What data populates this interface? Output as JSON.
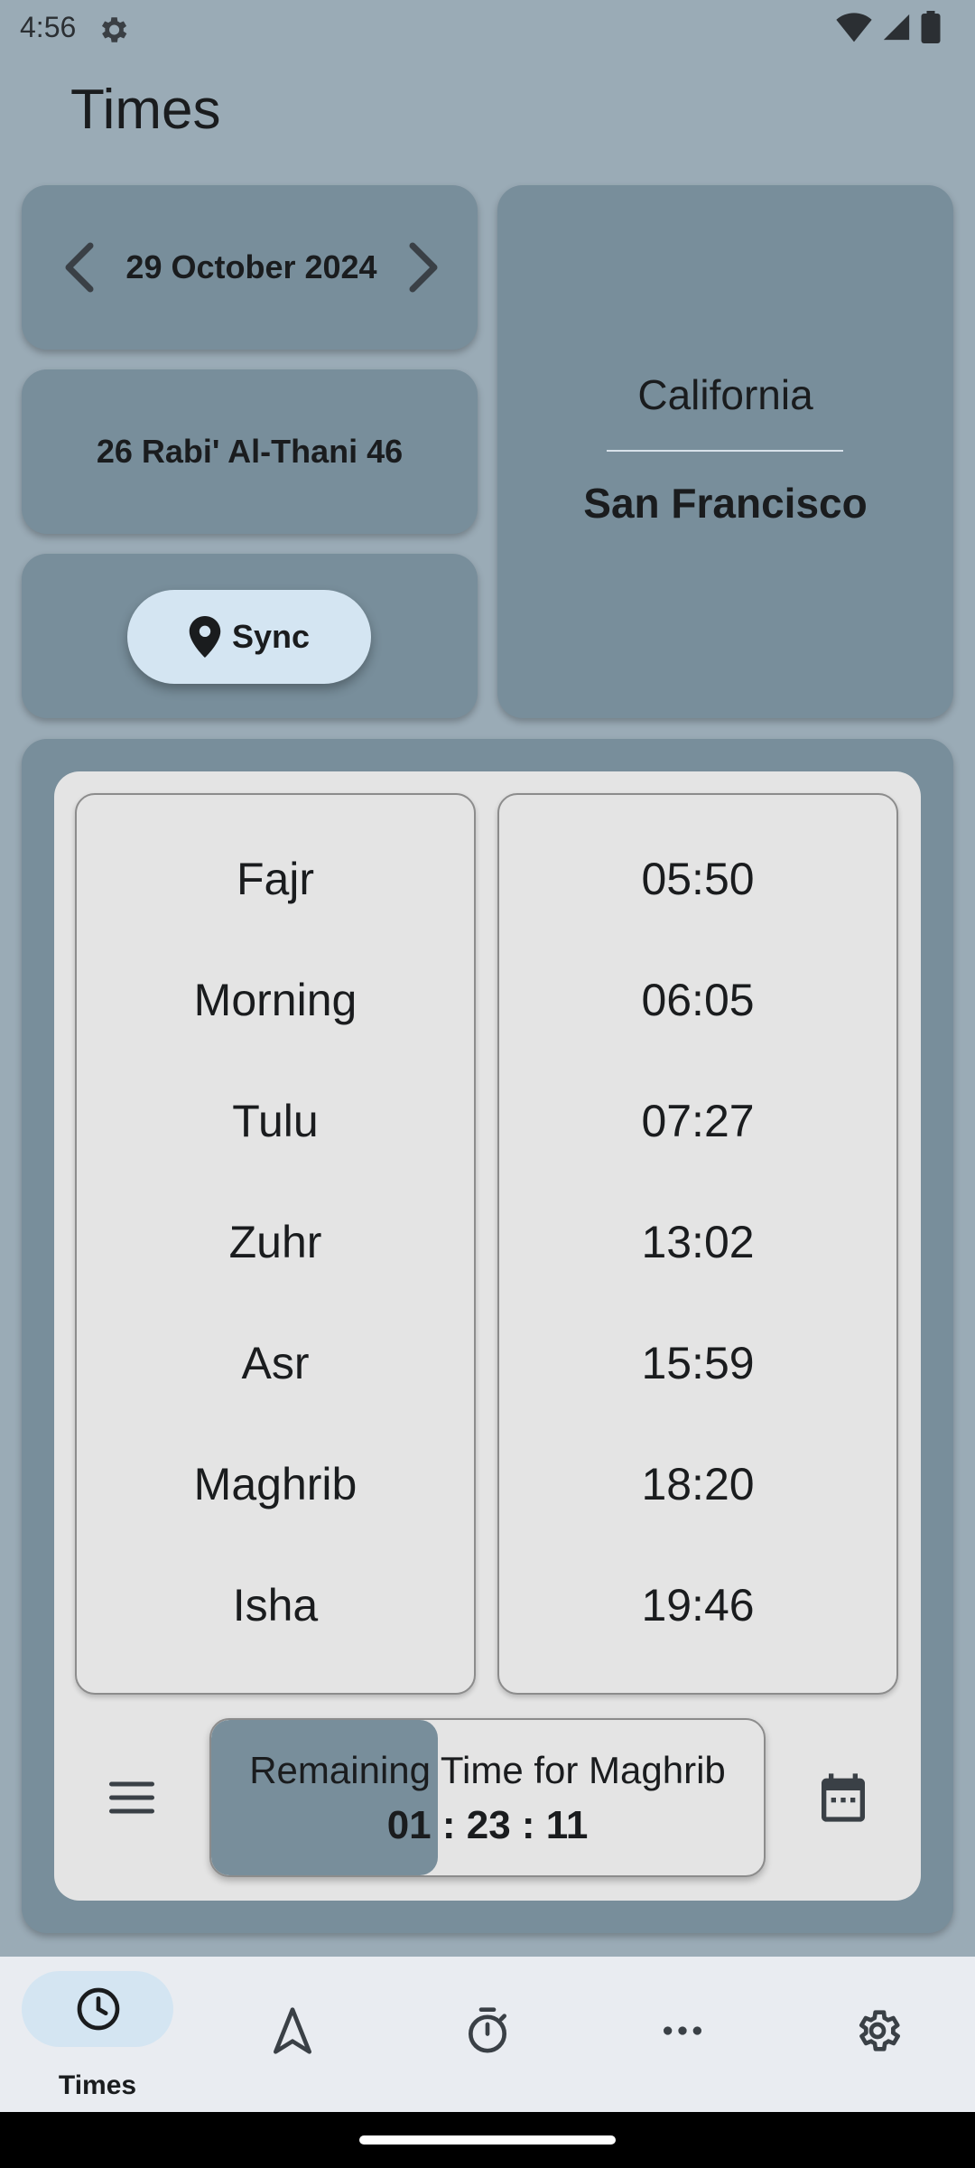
{
  "status_bar": {
    "time": "4:56",
    "icons": [
      "settings-icon",
      "wifi-icon",
      "cell-signal-icon",
      "battery-icon"
    ]
  },
  "header": {
    "title": "Times"
  },
  "date_card": {
    "gregorian": "29 October 2024"
  },
  "hijri_card": {
    "hijri": "26 Rabi' Al-Thani 46"
  },
  "sync": {
    "label": "Sync"
  },
  "location": {
    "region": "California",
    "city": "San Francisco"
  },
  "prayers": [
    {
      "name": "Fajr",
      "time": "05:50"
    },
    {
      "name": "Morning",
      "time": "06:05"
    },
    {
      "name": "Tulu",
      "time": "07:27"
    },
    {
      "name": "Zuhr",
      "time": "13:02"
    },
    {
      "name": "Asr",
      "time": "15:59"
    },
    {
      "name": "Maghrib",
      "time": "18:20"
    },
    {
      "name": "Isha",
      "time": "19:46"
    }
  ],
  "remaining": {
    "label": "Remaining Time for Maghrib",
    "countdown": "01 : 23 : 11",
    "progress_percent": 41
  },
  "bottom_nav": {
    "items": [
      {
        "label": "Times",
        "icon": "clock-icon",
        "active": true
      },
      {
        "label": "",
        "icon": "navigation-arrow-icon",
        "active": false
      },
      {
        "label": "",
        "icon": "stopwatch-icon",
        "active": false
      },
      {
        "label": "",
        "icon": "more-horizontal-icon",
        "active": false
      },
      {
        "label": "",
        "icon": "settings-gear-icon",
        "active": false
      }
    ]
  },
  "colors": {
    "background": "#9aabb6",
    "card": "#788e9b",
    "panel": "#e4e4e4",
    "accent_pill": "#d4e5f2",
    "nav_background": "#e9ecf1"
  }
}
